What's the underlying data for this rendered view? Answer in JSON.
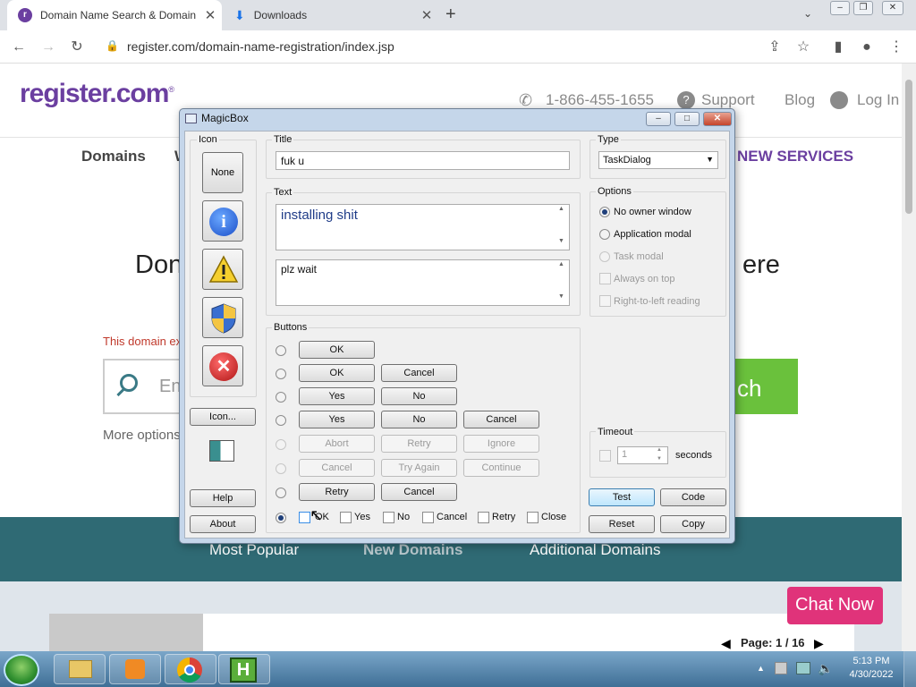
{
  "browser": {
    "tabs": [
      {
        "label": "Domain Name Search & Domain"
      },
      {
        "label": "Downloads"
      }
    ],
    "url": "register.com/domain-name-registration/index.jsp"
  },
  "site": {
    "logo": "register.com",
    "logo_mark": "®",
    "phone": "1-866-455-1655",
    "support": "Support",
    "blog": "Blog",
    "login": "Log In",
    "nav": [
      "Domains",
      "W",
      "NEW SERVICES"
    ],
    "hero_left": "Don",
    "hero_right": "ere",
    "domain_exists": "This domain ex",
    "search_placeholder": "Ent",
    "search_button": "ch",
    "more_options": "More options",
    "band_tabs": [
      "Most Popular",
      "New Domains",
      "Additional Domains"
    ],
    "chat": "Chat Now",
    "pager": "Page:  1  / 16"
  },
  "dialog": {
    "title": "MagicBox",
    "icon_label": "Icon",
    "icon_none": "None",
    "icon_custom": "Icon...",
    "help": "Help",
    "about": "About",
    "title_label": "Title",
    "title_value": "fuk u",
    "text_label": "Text",
    "text_main": "installing shit",
    "text_sub": "plz wait",
    "type_label": "Type",
    "type_value": "TaskDialog",
    "options_label": "Options",
    "options": [
      "No owner window",
      "Application modal",
      "Task modal"
    ],
    "checkboxes": [
      "Always on top",
      "Right-to-left reading"
    ],
    "buttons_label": "Buttons",
    "rows": [
      [
        "OK"
      ],
      [
        "OK",
        "Cancel"
      ],
      [
        "Yes",
        "No"
      ],
      [
        "Yes",
        "No",
        "Cancel"
      ],
      [
        "Abort",
        "Retry",
        "Ignore"
      ],
      [
        "Cancel",
        "Try Again",
        "Continue"
      ],
      [
        "Retry",
        "Cancel"
      ]
    ],
    "custom": [
      "OK",
      "Yes",
      "No",
      "Cancel",
      "Retry",
      "Close"
    ],
    "timeout_label": "Timeout",
    "timeout_value": "1",
    "seconds": "seconds",
    "test": "Test",
    "code": "Code",
    "reset": "Reset",
    "copy": "Copy"
  },
  "taskbar": {
    "time": "5:13 PM",
    "date": "4/30/2022"
  }
}
